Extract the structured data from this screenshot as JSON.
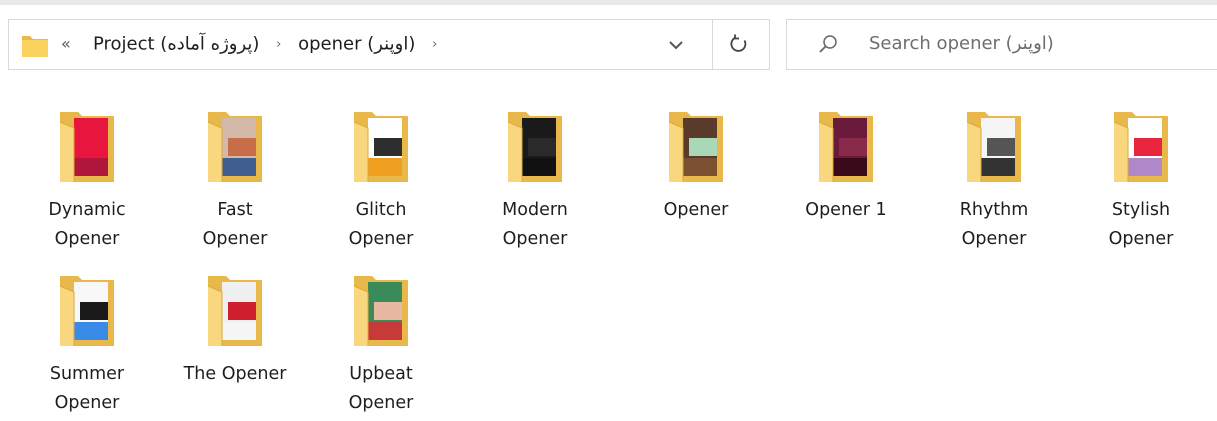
{
  "address_bar": {
    "overflow_glyph": "«",
    "crumbs": [
      "Project (پروژه آماده)",
      "opener (اوپنر)"
    ],
    "separator": "›"
  },
  "search": {
    "placeholder": "Search opener (اوپنر)"
  },
  "items": [
    {
      "line1": "Dynamic",
      "line2": "Opener",
      "thumb_colors": [
        "#e8163f",
        "#e8163f",
        "#b0153a"
      ]
    },
    {
      "line1": "Fast",
      "line2": "Opener",
      "thumb_colors": [
        "#d4b8a8",
        "#c86d4a",
        "#3f5f90"
      ]
    },
    {
      "line1": "Glitch",
      "line2": "Opener",
      "thumb_colors": [
        "#ffffff",
        "#2e2e2e",
        "#f0a020"
      ]
    },
    {
      "line1": "Modern",
      "line2": "Opener",
      "thumb_colors": [
        "#1a1a1a",
        "#2a2a2a",
        "#111111"
      ]
    },
    {
      "line1": "Opener",
      "line2": "",
      "thumb_colors": [
        "#5a3a2a",
        "#a8d8b8",
        "#7a5030"
      ]
    },
    {
      "line1": "Opener 1",
      "line2": "",
      "thumb_colors": [
        "#6a1a3a",
        "#8a2a4a",
        "#3a0a1a"
      ]
    },
    {
      "line1": "Rhythm",
      "line2": "Opener",
      "thumb_colors": [
        "#f5f5f5",
        "#555555",
        "#333333"
      ]
    },
    {
      "line1": "Stylish",
      "line2": "Opener",
      "thumb_colors": [
        "#ffffff",
        "#e8263f",
        "#b088c8"
      ]
    },
    {
      "line1": "Summer",
      "line2": "Opener",
      "thumb_colors": [
        "#f8f8f8",
        "#1a1a1a",
        "#3a8ae8"
      ]
    },
    {
      "line1": "The Opener",
      "line2": "",
      "thumb_colors": [
        "#f0f0f0",
        "#d02030",
        "#f5f5f5"
      ]
    },
    {
      "line1": "Upbeat",
      "line2": "Opener",
      "thumb_colors": [
        "#3a8a5a",
        "#e8b8a0",
        "#c83a3a"
      ]
    }
  ],
  "colors": {
    "folder_back": "#e8b84a",
    "folder_front": "#f9d77e",
    "folder_edge": "#dcaa3c"
  }
}
